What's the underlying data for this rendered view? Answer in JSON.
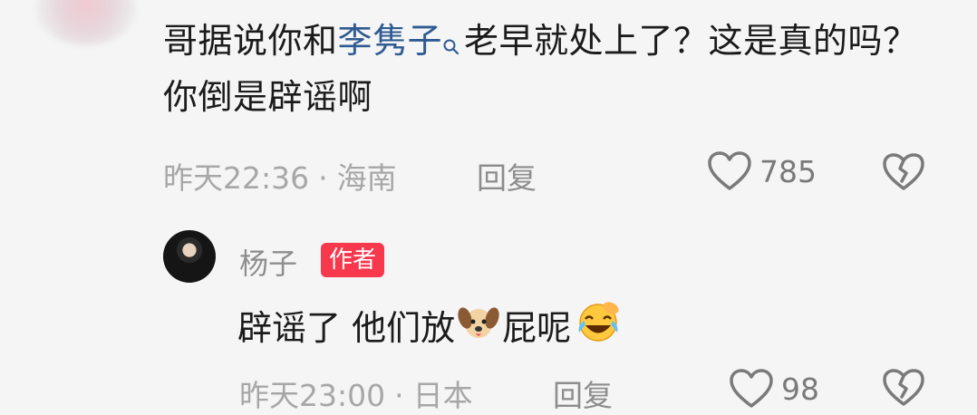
{
  "comment1": {
    "text_pre": "哥据说你和",
    "mention": "李隽子",
    "text_post": "老早就处上了？这是真的吗？你倒是辟谣啊",
    "time": "昨天22:36",
    "separator": "·",
    "location": "海南",
    "reply_label": "回复",
    "likes": "785"
  },
  "reply": {
    "author": "杨子",
    "badge": "作者",
    "text_a": "辟谣了 他们放",
    "text_b": "屁呢",
    "time": "昨天23:00",
    "separator": "·",
    "location": "日本",
    "reply_label": "回复",
    "likes": "98"
  },
  "icons": {
    "like": "heart-outline-icon",
    "dislike": "broken-heart-icon",
    "mention_search": "search-icon",
    "emoji_dog": "dog-emoji-icon",
    "emoji_laugh": "laughing-crying-emoji-icon"
  },
  "colors": {
    "background": "#f5f5f5",
    "mention": "#2f5b92",
    "badge": "#f7384d",
    "meta": "#a7a7a7"
  }
}
